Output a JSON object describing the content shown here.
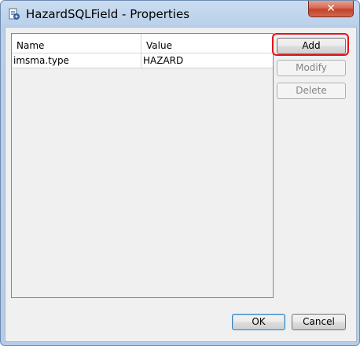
{
  "window": {
    "title": "HazardSQLField - Properties",
    "close_label": "✕"
  },
  "table": {
    "columns": [
      "Name",
      "Value"
    ],
    "rows": [
      {
        "name": "imsma.type",
        "value": "HAZARD"
      }
    ]
  },
  "buttons": {
    "add": "Add",
    "modify": "Modify",
    "delete": "Delete",
    "ok": "OK",
    "cancel": "Cancel"
  },
  "colors": {
    "annotation_red": "#e8101a",
    "title_bar": "#c9dcf1"
  }
}
